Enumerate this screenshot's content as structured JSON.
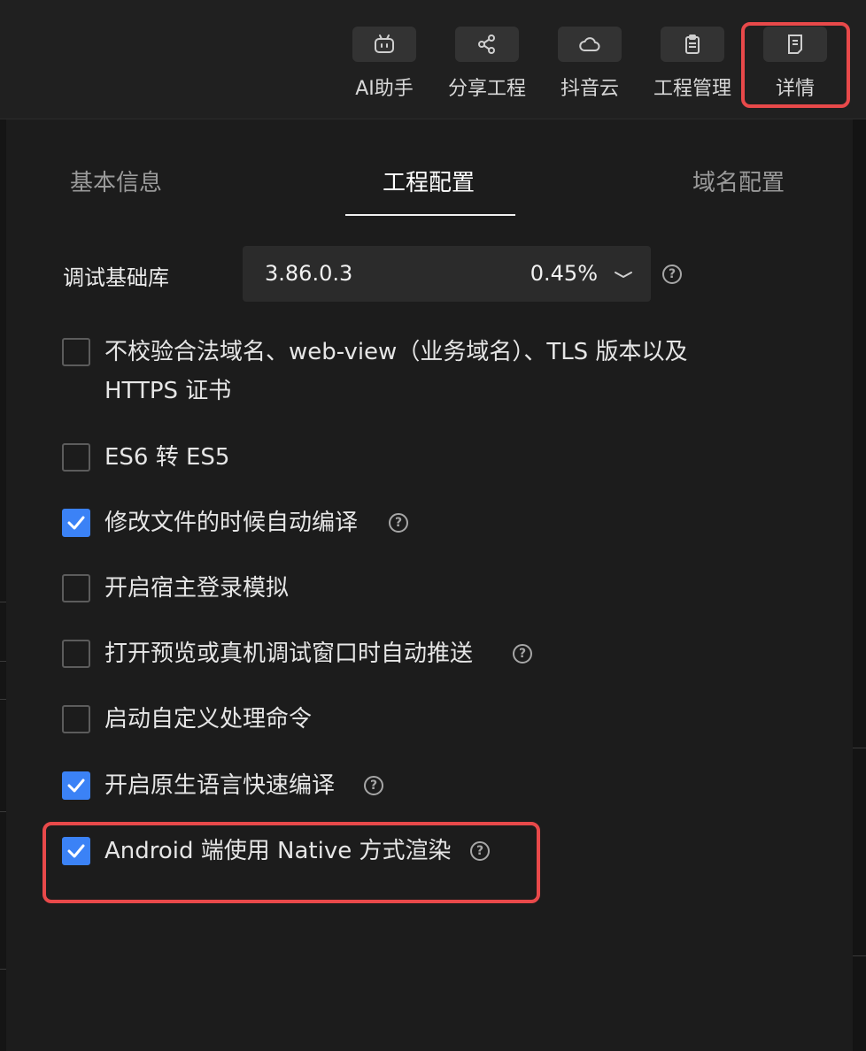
{
  "toolbar": {
    "items": [
      {
        "label": "AI助手",
        "icon": "robot-icon"
      },
      {
        "label": "分享工程",
        "icon": "share-icon"
      },
      {
        "label": "抖音云",
        "icon": "cloud-icon"
      },
      {
        "label": "工程管理",
        "icon": "clipboard-icon"
      },
      {
        "label": "详情",
        "icon": "document-icon"
      }
    ]
  },
  "tabs": [
    {
      "label": "基本信息",
      "active": false
    },
    {
      "label": "工程配置",
      "active": true
    },
    {
      "label": "域名配置",
      "active": false
    }
  ],
  "debug_lib": {
    "label": "调试基础库",
    "version": "3.86.0.3",
    "share": "0.45%"
  },
  "options": [
    {
      "line1": "不校验合法域名、web-view（业务域名）、TLS 版本以及",
      "line2": "HTTPS 证书",
      "checked": false,
      "help": false
    },
    {
      "line1": "ES6 转 ES5",
      "checked": false,
      "help": false
    },
    {
      "line1": "修改文件的时候自动编译",
      "checked": true,
      "help": true
    },
    {
      "line1": "开启宿主登录模拟",
      "checked": false,
      "help": false
    },
    {
      "line1": "打开预览或真机调试窗口时自动推送",
      "checked": false,
      "help": true
    },
    {
      "line1": "启动自定义处理命令",
      "checked": false,
      "help": false
    },
    {
      "line1": "开启原生语言快速编译",
      "checked": true,
      "help": true
    },
    {
      "line1": "Android 端使用 Native 方式渲染",
      "checked": true,
      "help": true
    }
  ],
  "help_glyph": "?",
  "colors": {
    "accent": "#3b82f6",
    "highlight": "#e8494a",
    "background": "#1c1c1c"
  }
}
